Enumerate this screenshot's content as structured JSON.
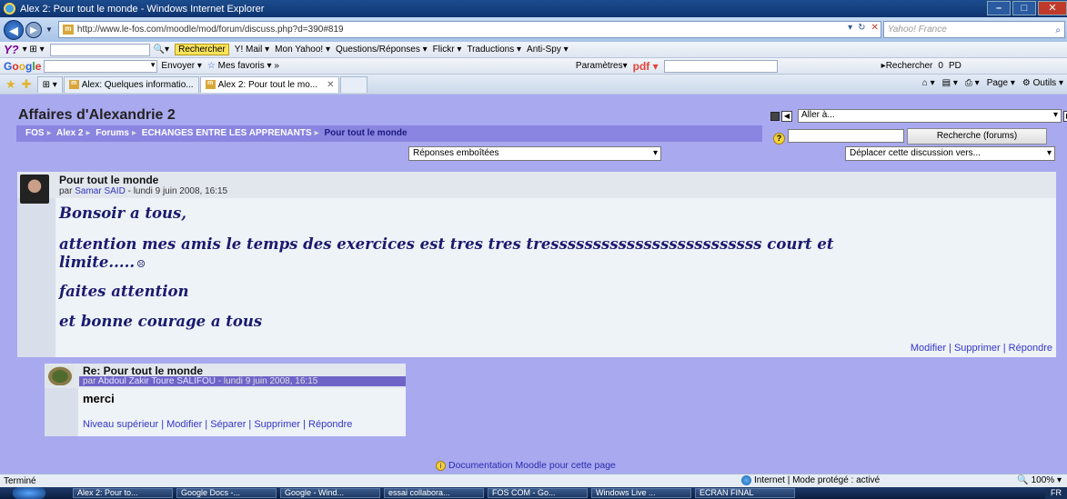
{
  "window": {
    "title": "Alex 2: Pour tout le monde - Windows Internet Explorer"
  },
  "address": {
    "url": "http://www.le-fos.com/moodle/mod/forum/discuss.php?d=390#819",
    "search_placeholder": "Yahoo! France"
  },
  "yahoo_toolbar": {
    "logo": "Y?",
    "items": [
      "Rechercher",
      "Y! Mail",
      "Mon Yahoo!",
      "Questions/Réponses",
      "Flickr",
      "Traductions",
      "Anti-Spy"
    ]
  },
  "google_toolbar": {
    "items": [
      "Envoyer",
      "Mes favoris",
      "Paramètres",
      "pdf"
    ],
    "search_label": "Rechercher",
    "count": "0",
    "pd": "PD"
  },
  "tabs": [
    {
      "label": "Alex: Quelques informatio...",
      "active": false
    },
    {
      "label": "Alex 2: Pour tout le mo...",
      "active": true
    }
  ],
  "ie_commands": [
    "Page",
    "Outils"
  ],
  "page": {
    "site_title": "Affaires d'Alexandrie 2",
    "goto_label": "Aller à...",
    "breadcrumb": [
      "FOS",
      "Alex 2",
      "Forums",
      "ECHANGES ENTRE LES APPRENANTS",
      "Pour tout le monde"
    ],
    "search_forums_button": "Recherche (forums)",
    "display_mode": "Réponses emboîtées",
    "move_discussion": "Déplacer cette discussion vers...",
    "help_symbol": "?"
  },
  "post": {
    "subject": "Pour tout le monde",
    "by": "par",
    "author": "Samar SAID",
    "date": " - lundi 9 juin 2008, 16:15",
    "lines": [
      "Bonsoir a tous,",
      "attention  mes amis le temps des exercices est tres tres tresssssssssssssssssssssssss court et",
      "limite.....",
      "faites attention",
      "et bonne courage a tous"
    ],
    "commands": "Modifier | Supprimer | Répondre"
  },
  "reply": {
    "subject": "Re: Pour tout le monde",
    "by": "par",
    "author": "Abdoul Zakir Toure SALIFOU",
    "date": " - lundi 9 juin 2008, 16:15",
    "message": "merci",
    "commands": "Niveau supérieur | Modifier | Séparer | Supprimer | Répondre"
  },
  "footer": {
    "moodle_doc": "Documentation Moodle pour cette page"
  },
  "status": {
    "left": "Terminé",
    "zone": "Internet | Mode protégé : activé",
    "zoom": "100%"
  },
  "taskbar": {
    "tasks": [
      "Alex 2: Pour to...",
      "Google Docs -...",
      "Google - Wind...",
      "essai collabora...",
      "FOS COM - Go...",
      "Windows Live ...",
      "ECRAN FINAL"
    ],
    "tray": "FR"
  }
}
